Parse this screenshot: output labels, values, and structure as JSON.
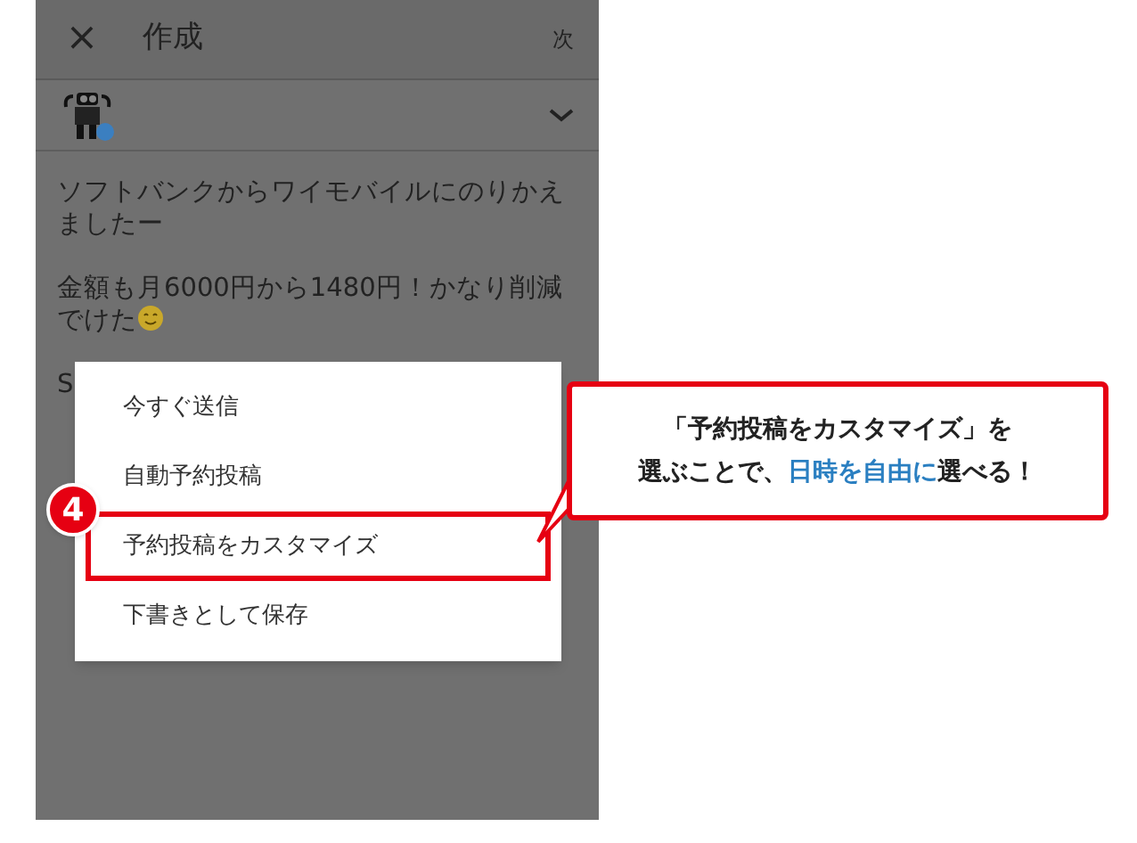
{
  "header": {
    "close": "×",
    "title": "作成",
    "next": "次"
  },
  "post": {
    "paragraphs": [
      "ソフトバンクからワイモバイルにのりかえましたー",
      "金額も月6000円から1480円！かなり削減でけた"
    ],
    "covered_fragments": [
      "S"
    ]
  },
  "menu": {
    "items": [
      {
        "label": "今すぐ送信",
        "selected": false
      },
      {
        "label": "自動予約投稿",
        "selected": false
      },
      {
        "label": "予約投稿をカスタマイズ",
        "selected": true
      },
      {
        "label": "下書きとして保存",
        "selected": false
      }
    ]
  },
  "annotation": {
    "step": "4",
    "callout_title": "「予約投稿をカスタマイズ」を",
    "callout": [
      {
        "text": "選ぶことで、",
        "highlight": false
      },
      {
        "text": "日時を自由に",
        "highlight": true
      },
      {
        "text": "選べる！",
        "highlight": false
      }
    ]
  }
}
